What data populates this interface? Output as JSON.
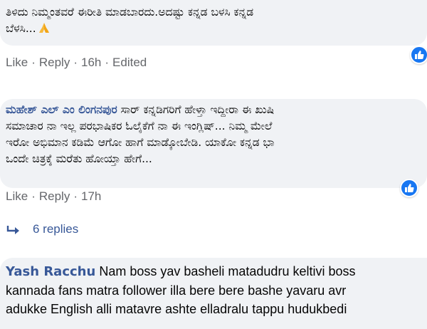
{
  "comments": [
    {
      "author": "",
      "lines": [
        "ತಿಳಿದು ನಿಮ್ಮಂತವರೆ ಈರೀತಿ ಮಾಡಬಾರದು.ಅದಷ್ಟು ಕನ್ನಡ ಬಳಸಿ ಕನ್ನಡ",
        "ಬೆಳಸಿ..."
      ],
      "emoji": "folded-hands",
      "actions": {
        "like": "Like",
        "reply": "Reply",
        "time": "16h",
        "edited": "Edited"
      }
    },
    {
      "author": "ಮಹೇಶ್ ಎಲ್ ಎಂ ಲಿಂಗನಪುರ",
      "lines": [
        " ಸಾರ್ ಕನ್ನಡಿಗರಿಗೆ ಹೇಳ್ತಾ ಇದ್ದೀರಾ ಈ ಖುಷಿ",
        "ಸಮಾಚಾರ ನಾ ಇಲ್ಲ ಪರಭಾಷಿಕರ ಓಲೈಕೆಗೆ ನಾ ಈ ಇಂಗ್ಲಿಷ್... ನಿಮ್ಮ ಮೇಲೆ",
        "ಇರೋ ಅಭಿಮಾನ ಕಡಿಮೆ ಆಗೋ ಹಾಗೆ ಮಾಡ್ಕೋಬೇಡಿ. ಯಾಕೋ ಕನ್ನಡ ಭಾ",
        "ಒಂದೇ ಚಿತ್ರಕ್ಕೆ ಮರೆತು ಹೋಯ್ತಾ ಹೇಗೆ..."
      ],
      "actions": {
        "like": "Like",
        "reply": "Reply",
        "time": "17h"
      },
      "replies": "6 replies"
    },
    {
      "author": "Yash Racchu",
      "lines": [
        " Nam boss yav basheli matadudru keltivi boss",
        "kannada fans matra follower illa bere bere bashe yavaru avr",
        "adukke English alli matavre ashte elladralu tappu hudukbedi"
      ]
    }
  ],
  "icons": {
    "like_badge": "like-thumb-icon",
    "reply_arrow": "reply-arrow-icon"
  },
  "colors": {
    "bubble_bg": "#f0f2f5",
    "author": "#385898",
    "meta": "#65676b",
    "like_blue": "#1877f2"
  }
}
